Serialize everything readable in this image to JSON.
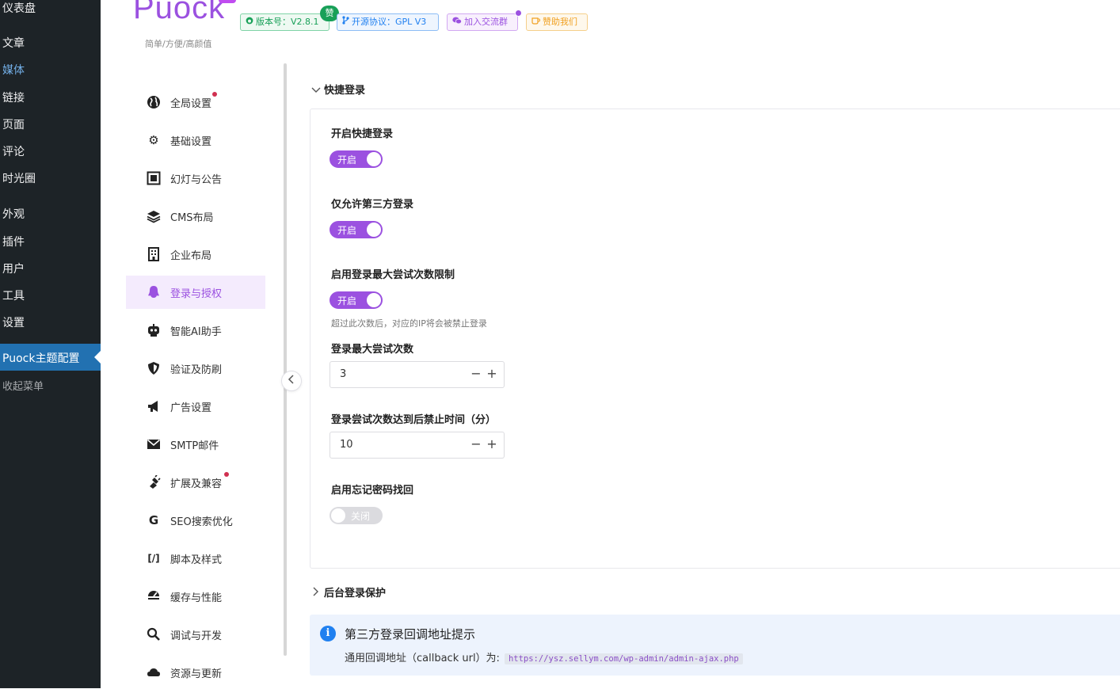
{
  "wp_menu": {
    "items": [
      {
        "label": "仪表盘"
      },
      {
        "label": "文章"
      },
      {
        "label": "媒体"
      },
      {
        "label": "链接"
      },
      {
        "label": "页面"
      },
      {
        "label": "评论"
      },
      {
        "label": "时光圈"
      },
      {
        "label": "外观"
      },
      {
        "label": "插件"
      },
      {
        "label": "用户"
      },
      {
        "label": "工具"
      },
      {
        "label": "设置"
      }
    ],
    "active": "Puock主题配置",
    "collapse": "收起菜单"
  },
  "brand": {
    "logo": "Puock",
    "subtitle": "简单/方便/高颜值"
  },
  "badges": {
    "version": "版本号：V2.8.1",
    "zan": "赞",
    "license": "开源协议：GPL V3",
    "group": "加入交流群",
    "donate": "赞助我们"
  },
  "nav": {
    "items": [
      {
        "label": "全局设置",
        "icon": "globe-icon"
      },
      {
        "label": "基础设置",
        "icon": "gear-icon"
      },
      {
        "label": "幻灯与公告",
        "icon": "slides-icon"
      },
      {
        "label": "CMS布局",
        "icon": "layers-icon"
      },
      {
        "label": "企业布局",
        "icon": "building-icon"
      },
      {
        "label": "登录与授权",
        "icon": "penguin-icon"
      },
      {
        "label": "智能AI助手",
        "icon": "robot-icon"
      },
      {
        "label": "验证及防刷",
        "icon": "shield-icon"
      },
      {
        "label": "广告设置",
        "icon": "megaphone-icon"
      },
      {
        "label": "SMTP邮件",
        "icon": "mail-icon"
      },
      {
        "label": "扩展及兼容",
        "icon": "plugin-icon"
      },
      {
        "label": "SEO搜索优化",
        "icon": "google-icon"
      },
      {
        "label": "脚本及样式",
        "icon": "code-icon"
      },
      {
        "label": "缓存与性能",
        "icon": "speed-icon"
      },
      {
        "label": "调试与开发",
        "icon": "search-icon"
      },
      {
        "label": "资源与更新",
        "icon": "cloud-icon"
      }
    ],
    "active_index": 5
  },
  "quick_login": {
    "title": "快捷登录",
    "fields": {
      "enable_quick_login": {
        "label": "开启快捷登录",
        "state": "开启"
      },
      "only_third_party": {
        "label": "仅允许第三方登录",
        "state": "开启"
      },
      "max_attempts_limit": {
        "label": "启用登录最大尝试次数限制",
        "state": "开启",
        "desc": "超过此次数后，对应的IP将会被禁止登录"
      },
      "max_attempts": {
        "label": "登录最大尝试次数",
        "value": "3"
      },
      "ban_time": {
        "label": "登录尝试次数达到后禁止时间（分）",
        "value": "10"
      },
      "forgot_password": {
        "label": "启用忘记密码找回",
        "state": "关闭"
      }
    }
  },
  "backend_protect": {
    "title": "后台登录保护"
  },
  "alert": {
    "title": "第三方登录回调地址提示",
    "body_prefix": "通用回调地址（callback url）为:",
    "url": "https://ysz.sellym.com/wp-admin/admin-ajax.php"
  },
  "colors": {
    "accent": "#9b51e0",
    "wp_sidebar": "#1d2327",
    "wp_active": "#2271b1",
    "info": "#2080f0",
    "success": "#18a058"
  }
}
